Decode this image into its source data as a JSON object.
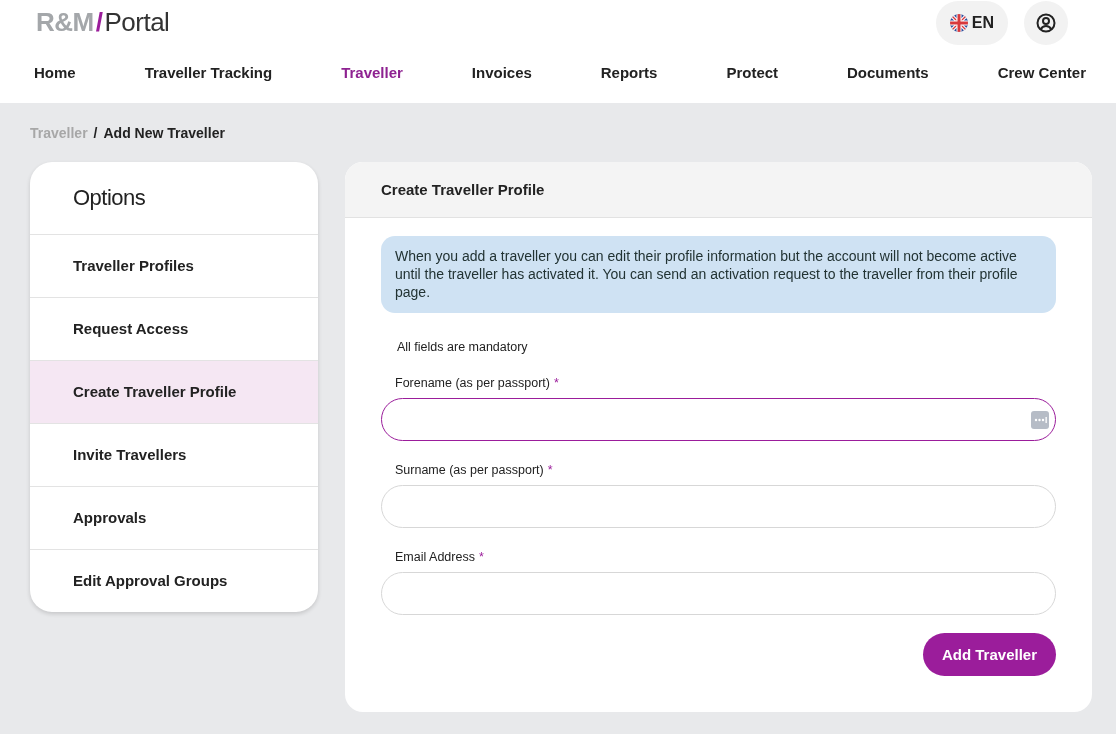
{
  "logo": {
    "brand": "R&M",
    "separator": "/",
    "product": "Portal"
  },
  "language": {
    "label": "EN"
  },
  "nav": [
    {
      "label": "Home",
      "selected": false
    },
    {
      "label": "Traveller Tracking",
      "selected": false
    },
    {
      "label": "Traveller",
      "selected": true
    },
    {
      "label": "Invoices",
      "selected": false
    },
    {
      "label": "Reports",
      "selected": false
    },
    {
      "label": "Protect",
      "selected": false
    },
    {
      "label": "Documents",
      "selected": false
    },
    {
      "label": "Crew Center",
      "selected": false
    }
  ],
  "breadcrumb": [
    {
      "label": "Traveller",
      "kind": "link"
    },
    {
      "label": "/",
      "kind": "separator"
    },
    {
      "label": "Add New Traveller",
      "kind": "current"
    }
  ],
  "sidebar": {
    "title": "Options",
    "items": [
      {
        "label": "Traveller Profiles",
        "selected": false
      },
      {
        "label": "Request Access",
        "selected": false
      },
      {
        "label": "Create Traveller Profile",
        "selected": true
      },
      {
        "label": "Invite Travellers",
        "selected": false
      },
      {
        "label": "Approvals",
        "selected": false
      },
      {
        "label": "Edit Approval Groups",
        "selected": false
      }
    ]
  },
  "form": {
    "title": "Create Traveller Profile",
    "info": "When you add a traveller you can edit their profile information but the account will not become active until the traveller has activated it. You can send an activation request to the traveller from their profile page.",
    "note": "All fields are mandatory",
    "fields": [
      {
        "label": "Forename (as per passport)",
        "required": "*",
        "focused": true,
        "autofill_icon": true
      },
      {
        "label": "Surname (as per passport)",
        "required": "*",
        "focused": false,
        "autofill_icon": false
      },
      {
        "label": "Email Address",
        "required": "*",
        "focused": false,
        "autofill_icon": false
      }
    ],
    "submit": "Add Traveller"
  }
}
